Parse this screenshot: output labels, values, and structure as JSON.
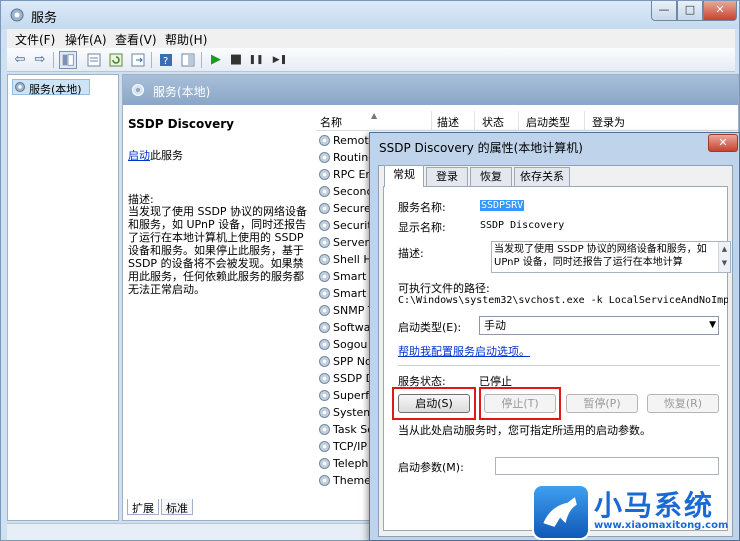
{
  "window": {
    "title": "服务",
    "controls": {
      "minimize": "—",
      "maximize": "□",
      "close": "✕"
    }
  },
  "menu": [
    "文件(F)",
    "操作(A)",
    "查看(V)",
    "帮助(H)"
  ],
  "toolbar": [
    "back-arrow-icon",
    "forward-arrow-icon",
    "console-tree-icon",
    "properties-icon",
    "refresh-icon",
    "export-icon",
    "help-icon",
    "show-hide-icon",
    "play-icon",
    "stop-icon",
    "pause-icon",
    "restart-icon"
  ],
  "toolbar_glyphs": {
    "back": "⇦",
    "forward": "⇨",
    "play": "▶",
    "stop": "■",
    "pause": "❚❚",
    "restart": "▶❚"
  },
  "tree": {
    "root": "服务(本地)"
  },
  "detail": {
    "header": "服务(本地)",
    "service_name": "SSDP Discovery",
    "start_link": "启动",
    "start_suffix": "此服务",
    "description_label": "描述:",
    "description": "当发现了使用 SSDP 协议的网络设备和服务，如 UPnP 设备，同时还报告了运行在本地计算机上使用的 SSDP 设备和服务。如果停止此服务，基于 SSDP 的设备将不会被发现。如果禁用此服务，任何依赖此服务的服务都无法正常启动。"
  },
  "list": {
    "columns": [
      "名称",
      "描述",
      "状态",
      "启动类型",
      "登录为"
    ],
    "services": [
      "Remote",
      "Routing",
      "RPC End",
      "Second",
      "Secure S",
      "Security",
      "Server",
      "Shell Ha",
      "Smart C",
      "Smart C",
      "SNMP T",
      "Software",
      "Sogou C",
      "SPP Not",
      "SSDP Di",
      "Superfe",
      "System",
      "Task Sch",
      "TCP/IP",
      "Telepho",
      "Themes"
    ]
  },
  "bottom_tabs": [
    "扩展",
    "标准"
  ],
  "dialog": {
    "title": "SSDP Discovery 的属性(本地计算机)",
    "tabs": [
      "常规",
      "登录",
      "恢复",
      "依存关系"
    ],
    "service_name_label": "服务名称:",
    "service_name_value": "SSDPSRV",
    "display_name_label": "显示名称:",
    "display_name_value": "SSDP Discovery",
    "description_label": "描述:",
    "description_value": "当发现了使用 SSDP 协议的网络设备和服务，如 UPnP 设备，同时还报告了运行在本地计算",
    "path_label": "可执行文件的路径:",
    "path_value": "C:\\Windows\\system32\\svchost.exe -k LocalServiceAndNoImpersor",
    "startup_type_label": "启动类型(E):",
    "startup_type_value": "手动",
    "help_link": "帮助我配置服务启动选项。",
    "status_label": "服务状态:",
    "status_value": "已停止",
    "buttons": {
      "start": "启动(S)",
      "stop": "停止(T)",
      "pause": "暂停(P)",
      "resume": "恢复(R)"
    },
    "hint": "当从此处启动服务时，您可指定所适用的启动参数。",
    "params_label": "启动参数(M):",
    "params_value": ""
  },
  "watermark": {
    "title": "小马系统",
    "url": "www.xiaomaxitong.com"
  },
  "colors": {
    "accent": "#1a6ad6",
    "highlight_red": "#e01818",
    "selection": "#3399ff"
  }
}
